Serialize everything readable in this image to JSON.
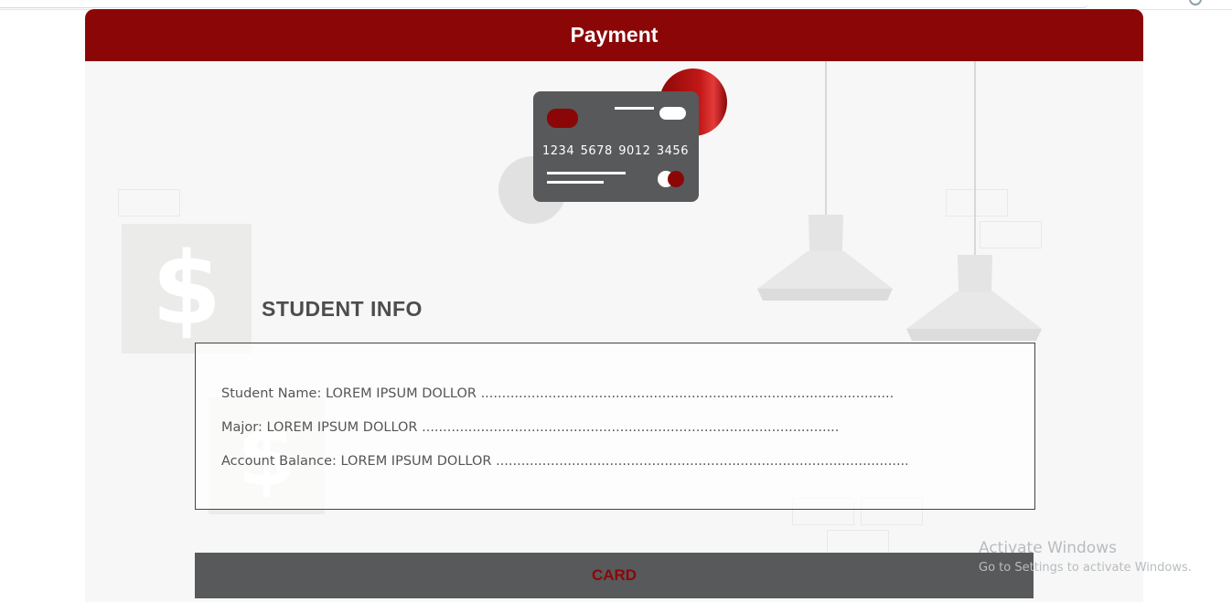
{
  "header": {
    "title": "Payment"
  },
  "card_illustration": {
    "number_groups": [
      "1234",
      "5678",
      "9012",
      "3456"
    ],
    "accent_color": "#8b0707"
  },
  "background_icons": {
    "dollar_symbol": "$"
  },
  "student_info": {
    "title": "STUDENT INFO",
    "fields": [
      {
        "text": "Student Name: LOREM IPSUM DOLLOR ......................................................................................................................"
      },
      {
        "text": "Major: LOREM IPSUM DOLLOR ......................................................................................................................"
      },
      {
        "text": "Account Balance: LOREM IPSUM DOLLOR ......................................................................................................................"
      }
    ]
  },
  "card_section": {
    "label": "CARD"
  },
  "watermark": {
    "line1": "Activate Windows",
    "line2": "Go to Settings to activate Windows."
  },
  "colors": {
    "primary": "#8b0707",
    "panel_bg": "#f7f7f7",
    "card_body": "#58595b"
  }
}
